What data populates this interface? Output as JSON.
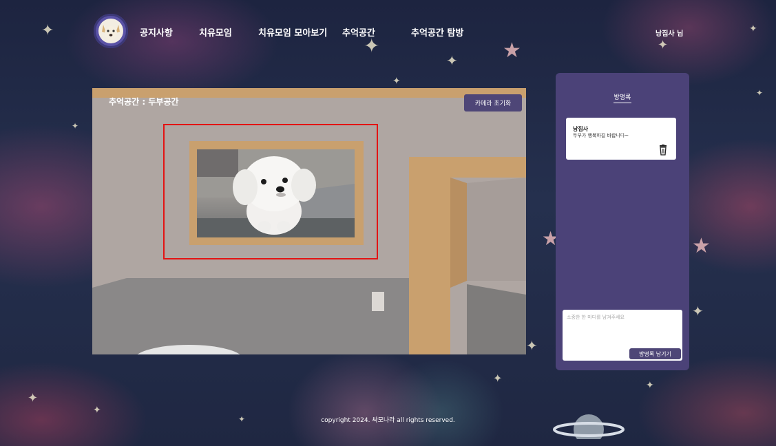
{
  "header": {
    "nav": [
      "공지사항",
      "치유모임",
      "치유모임 모아보기",
      "추억공간",
      "추억공간 탐방"
    ],
    "user_name": "낭집사 님"
  },
  "room": {
    "title": "추억공간 : 두부공간",
    "camera_reset_label": "카메라 초기화"
  },
  "guestbook": {
    "title": "방명록",
    "entries": [
      {
        "author": "낭집사",
        "message": "두부가 행복하길 바랍니다~"
      }
    ],
    "input_placeholder": "소중한 한 마디를 남겨주세요",
    "submit_label": "방명록 남기기"
  },
  "footer": {
    "copyright": "copyright 2024. 싸모나라 all rights reserved."
  },
  "colors": {
    "panel": "#4b4278",
    "button": "#4e4677",
    "wall": "#afa6a2",
    "frame_wood": "#c9a06e",
    "highlight": "#e31313"
  },
  "icons": [
    "dog-logo-icon",
    "trash-icon",
    "star-icon"
  ]
}
